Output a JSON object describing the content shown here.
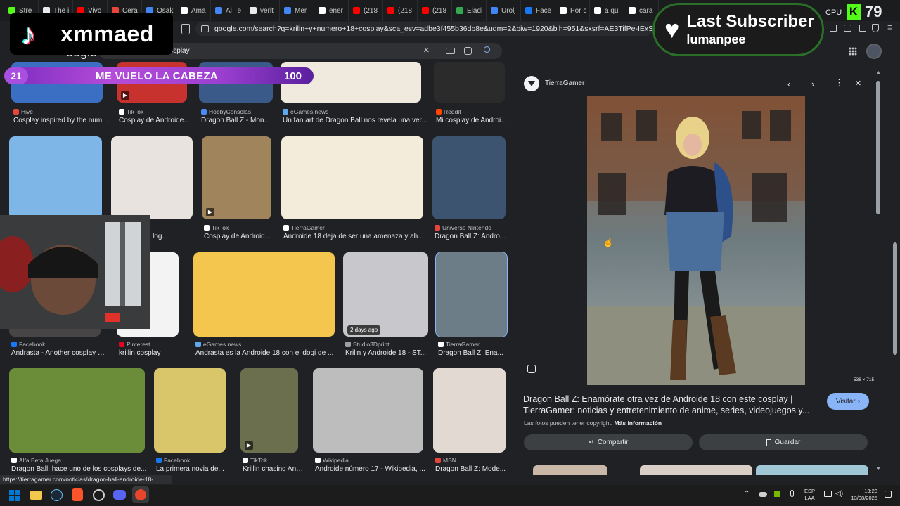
{
  "browser": {
    "tabs": [
      "Stre",
      "The i",
      "Vivo",
      "Cera",
      "Osak",
      "Ama",
      "Al Te",
      "verit",
      "Mer",
      "ener",
      "(218",
      "(218",
      "(218",
      "Eladi",
      "Urölj",
      "Face",
      "Por c",
      "a qu",
      "cara"
    ],
    "url": "google.com/search?q=krilin+y+numero+18+cosplay&sca_esv=adbe3f455b36db8e&udm=2&biw=1920&bih=951&sxsrf=AE3TifPe-IExS8afgBOt9Fjx...",
    "status_url": "https://tierragamer.com/noticias/dragon-ball-androide-18-cosplay/"
  },
  "google": {
    "logo": "oogle",
    "query": "krilin y numero 18 cosplay"
  },
  "overlay": {
    "tiktok_name": "xmmaed",
    "level": "21",
    "bar_text": "ME VUELO LA CABEZA",
    "bar_value": "100",
    "bar_fill_pct": 100,
    "last_sub_title": "Last Subscriber",
    "last_sub_name": "lumanpee",
    "cpu_label": "CPU",
    "cpu_value": "79"
  },
  "results": [
    {
      "source": "Hive",
      "title": "Cosplay inspired by the num...",
      "color": "#e8453c"
    },
    {
      "source": "TikTok",
      "title": "Cosplay de Androide...",
      "color": "#ffffff"
    },
    {
      "source": "HobbyConsolas",
      "title": "Dragon Ball Z - Mon...",
      "color": "#4a8cf7"
    },
    {
      "source": "eGames.news",
      "title": "Un fan art de Dragon Ball nos revela una ver...",
      "color": "#5fa8f0"
    },
    {
      "source": "Reddit",
      "title": "Mi cosplay de Androi...",
      "color": "#ff4500"
    },
    {
      "source": "",
      "title": "",
      "color": "#ffffff"
    },
    {
      "source": "",
      "title": "Colombiana log...",
      "color": "#ffffff"
    },
    {
      "source": "TikTok",
      "title": "Cosplay de Android...",
      "color": "#ffffff"
    },
    {
      "source": "TierraGamer",
      "title": "Androide 18 deja de ser una amenaza y ah...",
      "color": "#ffffff"
    },
    {
      "source": "Universo Nintendo",
      "title": "Dragon Ball Z: Andro...",
      "color": "#e8453c"
    },
    {
      "source": "Facebook",
      "title": "Andrasta - Another cosplay o...",
      "color": "#1877f2"
    },
    {
      "source": "Pinterest",
      "title": "krillin cosplay",
      "color": "#e60023"
    },
    {
      "source": "eGames.news",
      "title": "Andrasta es la Androide 18 con el dogi de ...",
      "color": "#5fa8f0"
    },
    {
      "source": "Studio3Dprint",
      "title": "Krilin y Androide 18 - ST...",
      "color": "#9aa0a6"
    },
    {
      "source": "TierraGamer",
      "title": "Dragon Ball Z: Ena...",
      "color": "#ffffff"
    },
    {
      "source": "Alfa Beta Juega",
      "title": "Dragon Ball: hace uno de los cosplays de...",
      "color": "#ffffff"
    },
    {
      "source": "Facebook",
      "title": "La primera novia de...",
      "color": "#1877f2"
    },
    {
      "source": "TikTok",
      "title": "Krillin chasing And...",
      "color": "#ffffff"
    },
    {
      "source": "Wikipedia",
      "title": "Androide número 17 - Wikipedia, ...",
      "color": "#ffffff"
    },
    {
      "source": "MSN",
      "title": "Dragon Ball Z: Mode...",
      "color": "#e8453c"
    }
  ],
  "badges": {
    "days_ago": "2 days ago"
  },
  "panel": {
    "site": "TierraGamer",
    "dimensions": "538 × 715",
    "title_line1": "Dragon Ball Z: Enamórate otra vez de Androide 18 con este cosplay |",
    "title_line2": "TierraGamer: noticias y entretenimiento de anime, series, videojuegos y...",
    "visit": "Visitar",
    "copyright": "Las fotos pueden tener copyright.",
    "more_info": "Más información",
    "share": "Compartir",
    "save": "Guardar"
  },
  "taskbar": {
    "lang1": "ESP",
    "lang2": "LAA",
    "time": "13:23",
    "date": "13/08/2025"
  }
}
